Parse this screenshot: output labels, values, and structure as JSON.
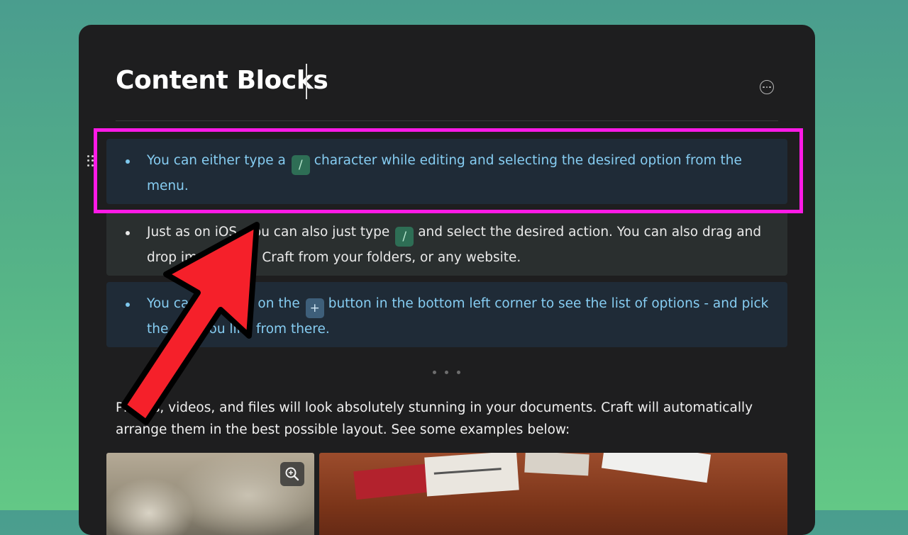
{
  "document": {
    "title": "Content Blocks"
  },
  "blocks": [
    {
      "before": "You can either type a",
      "chip": "/",
      "after": "character while editing and selecting the desired option from the menu."
    },
    {
      "before": "Just as on iOS, you can also just type",
      "chip": "/",
      "after": "and select the desired action. You can also drag and drop images into Craft from your folders, or any website."
    },
    {
      "before": "You can also tap on the",
      "chip": "+",
      "after": "button in the bottom left corner to see the list of options - and pick the one you like from there."
    }
  ],
  "paragraph": "Photos, videos, and files will look absolutely stunning in your documents. Craft will automatically arrange them in the best possible layout. See some examples below:",
  "icons": {
    "more": "more-options-icon",
    "drag": "drag-handle-icon",
    "zoom": "zoom-in-icon",
    "separator": "ellipsis-separator-icon"
  },
  "colors": {
    "highlight_outline": "#ff1ae6",
    "arrow_fill": "#f5202a",
    "window_bg": "#1e1e1f"
  }
}
